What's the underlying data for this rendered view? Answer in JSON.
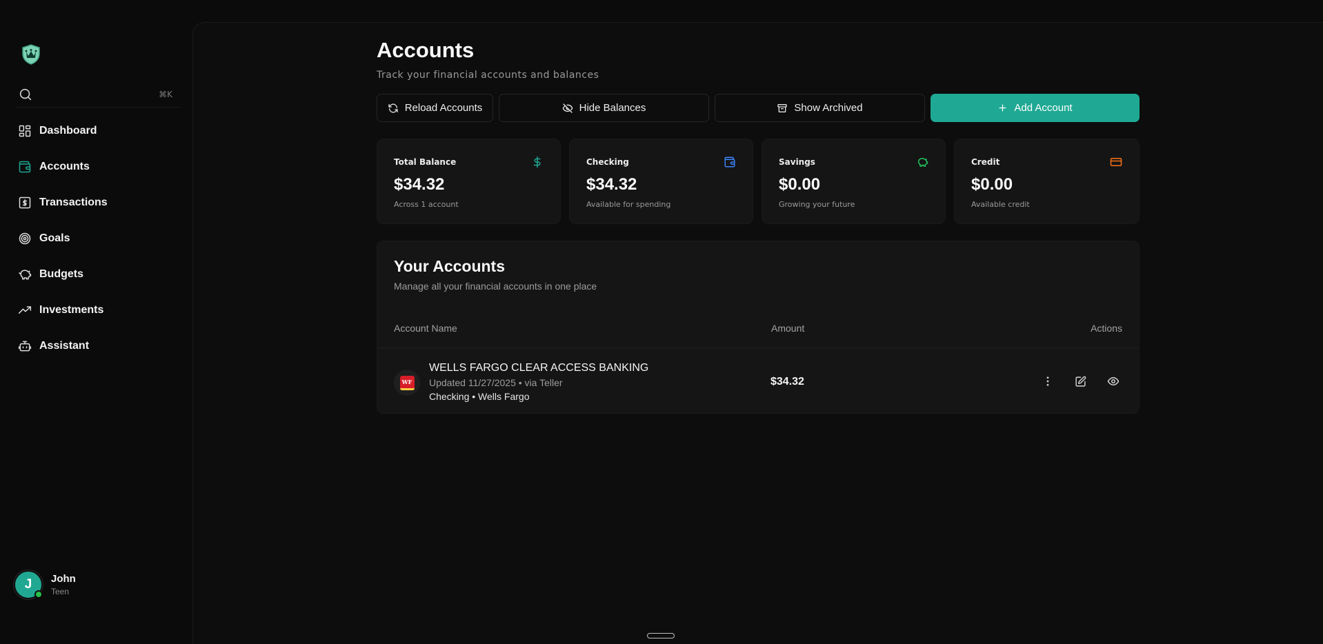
{
  "sidebar": {
    "search": {
      "shortcut": "⌘K",
      "placeholder": ""
    },
    "nav": [
      {
        "label": "Dashboard",
        "icon": "dashboard-grid-icon"
      },
      {
        "label": "Accounts",
        "icon": "wallet-icon",
        "active": true
      },
      {
        "label": "Transactions",
        "icon": "dollar-receipt-icon"
      },
      {
        "label": "Goals",
        "icon": "target-icon"
      },
      {
        "label": "Budgets",
        "icon": "piggy-bank-icon"
      },
      {
        "label": "Investments",
        "icon": "trending-up-icon"
      },
      {
        "label": "Assistant",
        "icon": "bot-icon"
      }
    ],
    "user": {
      "initial": "J",
      "name": "John",
      "role": "Teen",
      "status": "online"
    }
  },
  "page": {
    "title": "Accounts",
    "subtitle": "Track your financial accounts and balances"
  },
  "toolbar": {
    "reload": "Reload Accounts",
    "hide": "Hide Balances",
    "archived": "Show Archived",
    "add": "Add Account"
  },
  "stats": [
    {
      "label": "Total Balance",
      "value": "$34.32",
      "caption": "Across 1 account",
      "icon": "dollar-icon",
      "color": "#1fa994"
    },
    {
      "label": "Checking",
      "value": "$34.32",
      "caption": "Available for spending",
      "icon": "wallet-icon",
      "color": "#3b82f6"
    },
    {
      "label": "Savings",
      "value": "$0.00",
      "caption": "Growing your future",
      "icon": "piggy-bank-icon",
      "color": "#22c55e"
    },
    {
      "label": "Credit",
      "value": "$0.00",
      "caption": "Available credit",
      "icon": "credit-card-icon",
      "color": "#f97316"
    }
  ],
  "accounts": {
    "title": "Your Accounts",
    "subtitle": "Manage all your financial accounts in one place",
    "columns": {
      "name": "Account Name",
      "amount": "Amount",
      "actions": "Actions"
    },
    "rows": [
      {
        "logo_text": "WF",
        "name": "WELLS FARGO CLEAR ACCESS BANKING",
        "updated": "Updated 11/27/2025 • via Teller",
        "type": "Checking • Wells Fargo",
        "amount": "$34.32"
      }
    ]
  },
  "colors": {
    "accent": "#1fa994",
    "background": "#0b0b0b",
    "card": "#151515"
  }
}
